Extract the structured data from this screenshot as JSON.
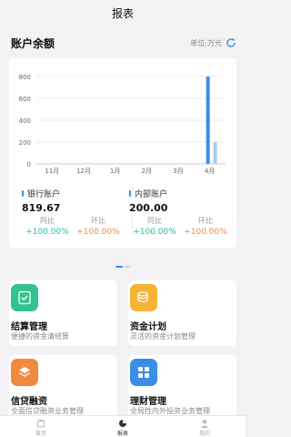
{
  "header": {
    "title": "报表"
  },
  "balance": {
    "title": "账户余额",
    "unit": "单位:万元",
    "refresh_icon": "refresh-icon"
  },
  "chart_data": {
    "type": "bar",
    "categories": [
      "11月",
      "12月",
      "1月",
      "2月",
      "3月",
      "4月"
    ],
    "series": [
      {
        "name": "银行账户",
        "values": [
          0,
          0,
          0,
          0,
          0,
          819.67
        ],
        "color": "#3a8ee6"
      },
      {
        "name": "内部账户",
        "values": [
          0,
          0,
          0,
          0,
          0,
          200.0
        ],
        "color": "#a9ccf2"
      }
    ],
    "ylim": [
      0,
      800
    ],
    "yticks": [
      "0",
      "200",
      "400",
      "600",
      "800"
    ],
    "grid": true
  },
  "accounts": [
    {
      "name": "银行账户",
      "value": "819.67",
      "yoy_label": "同比",
      "yoy": "+100.00%",
      "mom_label": "环比",
      "mom": "+100.00%"
    },
    {
      "name": "内部账户",
      "value": "200.00",
      "yoy_label": "同比",
      "yoy": "+100.00%",
      "mom_label": "环比",
      "mom": "+100.00%"
    }
  ],
  "tiles": [
    {
      "title": "结算管理",
      "desc": "便捷的资金清结算",
      "icon": "settlement-icon",
      "color": "#34c38f"
    },
    {
      "title": "资金计划",
      "desc": "灵活的资金计划管理",
      "icon": "fund-plan-icon",
      "color": "#f5b335"
    },
    {
      "title": "信贷融资",
      "desc": "全面信贷融资业务管理",
      "icon": "credit-icon",
      "color": "#f08a3c"
    },
    {
      "title": "理财管理",
      "desc": "全局性内外投资业务管理",
      "icon": "wealth-icon",
      "color": "#3a8ee6"
    }
  ],
  "tabbar": [
    {
      "label": "首页",
      "icon": "home-icon"
    },
    {
      "label": "报表",
      "icon": "report-icon"
    },
    {
      "label": "我的",
      "icon": "profile-icon"
    }
  ]
}
